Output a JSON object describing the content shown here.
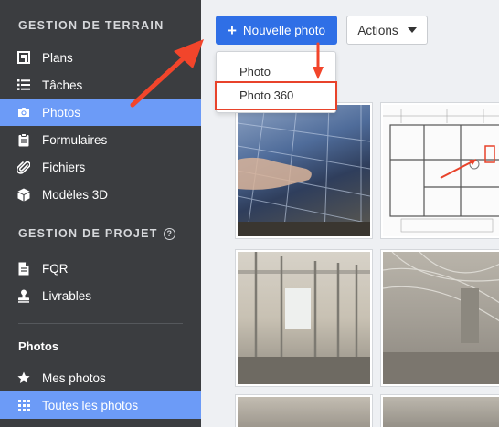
{
  "sidebar": {
    "section1_title": "GESTION DE TERRAIN",
    "items1": [
      {
        "label": "Plans",
        "icon": "plans-icon"
      },
      {
        "label": "Tâches",
        "icon": "list-icon"
      },
      {
        "label": "Photos",
        "icon": "camera-icon"
      },
      {
        "label": "Formulaires",
        "icon": "clipboard-icon"
      },
      {
        "label": "Fichiers",
        "icon": "paperclip-icon"
      },
      {
        "label": "Modèles 3D",
        "icon": "cube-icon"
      }
    ],
    "section2_title": "GESTION DE PROJET",
    "section2_help": "?",
    "items2": [
      {
        "label": "FQR",
        "icon": "document-icon"
      },
      {
        "label": "Livrables",
        "icon": "stamp-icon"
      }
    ],
    "photos_title": "Photos",
    "items3": [
      {
        "label": "Mes photos",
        "icon": "star-icon"
      },
      {
        "label": "Toutes les photos",
        "icon": "grid-icon"
      }
    ],
    "active_item": "Photos",
    "active_sub_item": "Toutes les photos"
  },
  "toolbar": {
    "new_photo_plus": "+",
    "new_photo_label": "Nouvelle photo",
    "actions_label": "Actions"
  },
  "dropdown": {
    "items": [
      "Photo",
      "Photo 360"
    ]
  },
  "colors": {
    "sidebar_bg": "#3b3d40",
    "active_bg": "#6c9bf7",
    "primary_button": "#2f6fe6",
    "annotation_red": "#e8432b"
  }
}
